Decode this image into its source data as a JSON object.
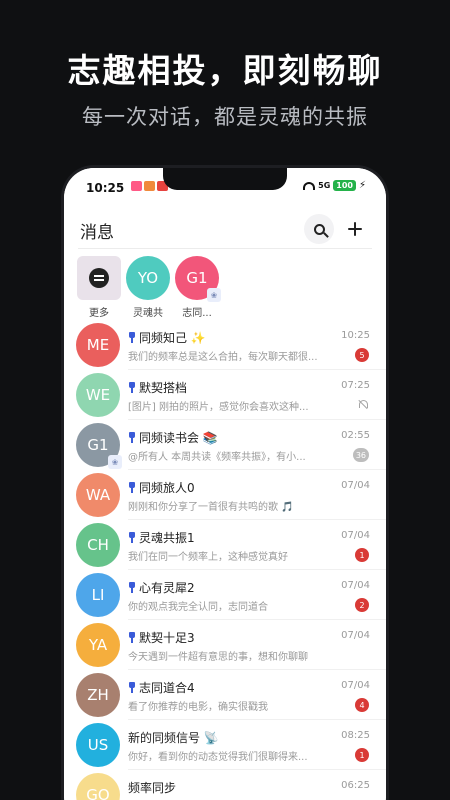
{
  "promo": {
    "title": "志趣相投，即刻畅聊",
    "subtitle": "每一次对话，都是灵魂的共振"
  },
  "status_bar": {
    "time": "10:25",
    "signal": "5G",
    "battery": "100"
  },
  "header": {
    "title": "消息"
  },
  "stories": [
    {
      "initials": "",
      "label": "更多",
      "color": "#e9e2ea",
      "icon": "archive-icon"
    },
    {
      "initials": "YO",
      "label": "灵魂共",
      "color": "#4fcbbf"
    },
    {
      "initials": "G1",
      "label": "志同...",
      "color": "#f2567a",
      "group": true
    }
  ],
  "conversations": [
    {
      "initials": "ME",
      "color": "#ea5f5d",
      "name": "同频知己 ✨",
      "pinned": true,
      "preview": "我们的频率总是这么合拍，每次聊天都很...",
      "time": "10:25",
      "badge": "5"
    },
    {
      "initials": "WE",
      "color": "#8fd6b0",
      "name": "默契搭档",
      "pinned": true,
      "preview": "[图片] 刚拍的照片，感觉你会喜欢这种...",
      "time": "07:25",
      "muted": true
    },
    {
      "initials": "G1",
      "color": "#8b98a3",
      "name": "同频读书会 📚",
      "pinned": true,
      "preview": "@所有人 本周共读《频率共振》，有小...",
      "time": "02:55",
      "badge": "36",
      "badge_grey": true,
      "group": true
    },
    {
      "initials": "WA",
      "color": "#f08a6a",
      "name": "同频旅人0",
      "pinned": true,
      "preview": "刚刚和你分享了一首很有共鸣的歌 🎵",
      "time": "07/04"
    },
    {
      "initials": "CH",
      "color": "#66c38b",
      "name": "灵魂共振1",
      "pinned": true,
      "preview": "我们在同一个频率上，这种感觉真好",
      "time": "07/04",
      "badge": "1"
    },
    {
      "initials": "LI",
      "color": "#4ea6ea",
      "name": "心有灵犀2",
      "pinned": true,
      "preview": "你的观点我完全认同，志同道合",
      "time": "07/04",
      "badge": "2"
    },
    {
      "initials": "YA",
      "color": "#f5ae3d",
      "name": "默契十足3",
      "pinned": true,
      "preview": "今天遇到一件超有意思的事，想和你聊聊",
      "time": "07/04"
    },
    {
      "initials": "ZH",
      "color": "#a8806f",
      "name": "志同道合4",
      "pinned": true,
      "preview": "看了你推荐的电影，确实很戳我",
      "time": "07/04",
      "badge": "4"
    },
    {
      "initials": "US",
      "color": "#22b0de",
      "name": "新的同频信号 📡",
      "pinned": false,
      "preview": "你好，看到你的动态觉得我们很聊得来...",
      "time": "08:25",
      "badge": "1"
    },
    {
      "initials": "GO",
      "color": "#f7dc8c",
      "name": "频率同步",
      "pinned": false,
      "preview": "",
      "time": "06:25",
      "badge": ""
    }
  ]
}
